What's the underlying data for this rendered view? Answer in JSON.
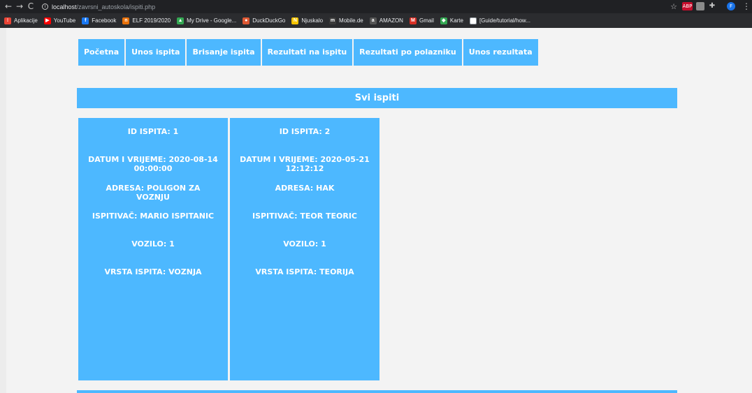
{
  "browser": {
    "url_host": "localhost",
    "url_path": "/zavrsni_autoskola/ispiti.php",
    "nav": {
      "back": "←",
      "forward": "→",
      "reload": "C"
    },
    "bookmarks": [
      {
        "label": "Aplikacije",
        "icon": "apps-grid-icon",
        "color": "#ea4335",
        "glyph": "⁝"
      },
      {
        "label": "YouTube",
        "icon": "youtube-icon",
        "color": "#ff0000",
        "glyph": "▶"
      },
      {
        "label": "Facebook",
        "icon": "facebook-icon",
        "color": "#1877f2",
        "glyph": "f"
      },
      {
        "label": "ELF 2019/2020",
        "icon": "elf-icon",
        "color": "#e8710a",
        "glyph": "n"
      },
      {
        "label": "My Drive - Google...",
        "icon": "google-drive-icon",
        "color": "#34a853",
        "glyph": "▲"
      },
      {
        "label": "DuckDuckGo",
        "icon": "duckduckgo-icon",
        "color": "#de5833",
        "glyph": "●"
      },
      {
        "label": "Njuskalo",
        "icon": "njuskalo-icon",
        "color": "#f5c400",
        "glyph": "N"
      },
      {
        "label": "Mobile.de",
        "icon": "mobilede-icon",
        "color": "#3a3a3a",
        "glyph": "m"
      },
      {
        "label": "AMAZON",
        "icon": "amazon-icon",
        "color": "#555555",
        "glyph": "a"
      },
      {
        "label": "Gmail",
        "icon": "gmail-icon",
        "color": "#d93025",
        "glyph": "M"
      },
      {
        "label": "Karte",
        "icon": "maps-icon",
        "color": "#34a853",
        "glyph": "◆"
      },
      {
        "label": "[Guide/tutorial/how...",
        "icon": "page-icon",
        "color": "#ffffff",
        "glyph": ""
      }
    ],
    "extensions": [
      {
        "label": "ABP",
        "icon": "adblock-icon",
        "color": "#c70d2c"
      },
      {
        "label": "",
        "icon": "extension-square-icon",
        "color": "#8a8a8a"
      },
      {
        "label": "",
        "icon": "puzzle-icon",
        "color": "#c8c8c8"
      },
      {
        "label": "F",
        "icon": "profile-avatar-icon",
        "color": "#1a73e8"
      }
    ]
  },
  "menu": [
    {
      "label": "Početna"
    },
    {
      "label": "Unos ispita"
    },
    {
      "label": "Brisanje ispita"
    },
    {
      "label": "Rezultati na ispitu"
    },
    {
      "label": "Rezultati po polazniku"
    },
    {
      "label": "Unos rezultata"
    }
  ],
  "section_title": "Svi ispiti",
  "exams": [
    {
      "id": "ID ISPITA: 1",
      "datetime": "DATUM I VRIJEME: 2020-08-14 00:00:00",
      "address": "ADRESA: POLIGON ZA VOZNJU",
      "examiner": "ISPITIVAČ: MARIO ISPITANIC",
      "vehicle": "VOZILO: 1",
      "type": "VRSTA ISPITA: VOZNJA"
    },
    {
      "id": "ID ISPITA: 2",
      "datetime": "DATUM I VRIJEME: 2020-05-21 12:12:12",
      "address": "ADRESA: HAK",
      "examiner": "ISPITIVAČ: TEOR TEORIC",
      "vehicle": "VOZILO: 1",
      "type": "VRSTA ISPITA: TEORIJA"
    }
  ],
  "colors": {
    "accent": "#4db8ff",
    "page_bg": "#f3f3f3"
  }
}
